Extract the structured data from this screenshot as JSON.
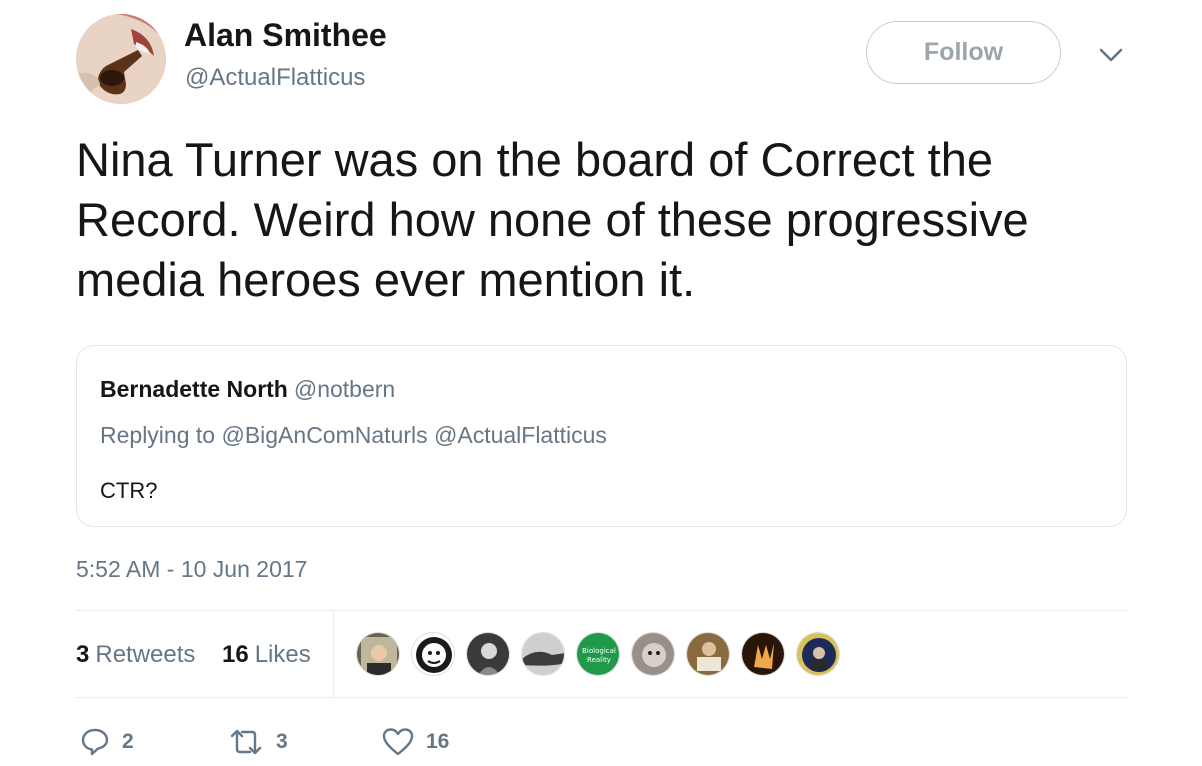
{
  "author": {
    "name": "Alan Smithee",
    "handle": "@ActualFlatticus",
    "avatar_icon": "pipe-avatar"
  },
  "follow_button": {
    "label": "Follow"
  },
  "menu_caret_icon": "chevron-down-icon",
  "tweet": {
    "text_lines": [
      "Nina Turner was on the board of Correct the",
      "Record.  Weird how none of these progressive",
      "media heroes ever mention it."
    ]
  },
  "quoted_tweet": {
    "name": "Bernadette North",
    "handle": "@notbern",
    "reply_prefix": "Replying to",
    "reply_mentions": [
      "@BigAnComNaturls",
      "@ActualFlatticus"
    ],
    "text": "CTR?"
  },
  "timestamp": "5:52 AM - 10 Jun 2017",
  "stats": {
    "retweets_count": "3",
    "retweets_label": "Retweets",
    "likes_count": "16",
    "likes_label": "Likes"
  },
  "likers": [
    {
      "icon": "liker-avatar-1",
      "color": "#6b6250"
    },
    {
      "icon": "liker-avatar-2",
      "color": "#1a1a1a"
    },
    {
      "icon": "liker-avatar-3",
      "color": "#3a3a3a"
    },
    {
      "icon": "liker-avatar-4",
      "color": "#7d7d7d"
    },
    {
      "icon": "liker-avatar-5",
      "color": "#1f9a4a",
      "text": "Biological Reality"
    },
    {
      "icon": "liker-avatar-6",
      "color": "#9a8f88"
    },
    {
      "icon": "liker-avatar-7",
      "color": "#8a6a3f"
    },
    {
      "icon": "liker-avatar-8",
      "color": "#2a1608"
    },
    {
      "icon": "liker-avatar-9",
      "color": "#1d2a5a"
    }
  ],
  "actions": {
    "reply": {
      "icon": "reply-icon",
      "count": "2"
    },
    "retweet": {
      "icon": "retweet-icon",
      "count": "3"
    },
    "like": {
      "icon": "heart-icon",
      "count": "16"
    }
  },
  "colors": {
    "text": "#14171a",
    "secondary": "#657786",
    "border": "#e1e8ed"
  }
}
